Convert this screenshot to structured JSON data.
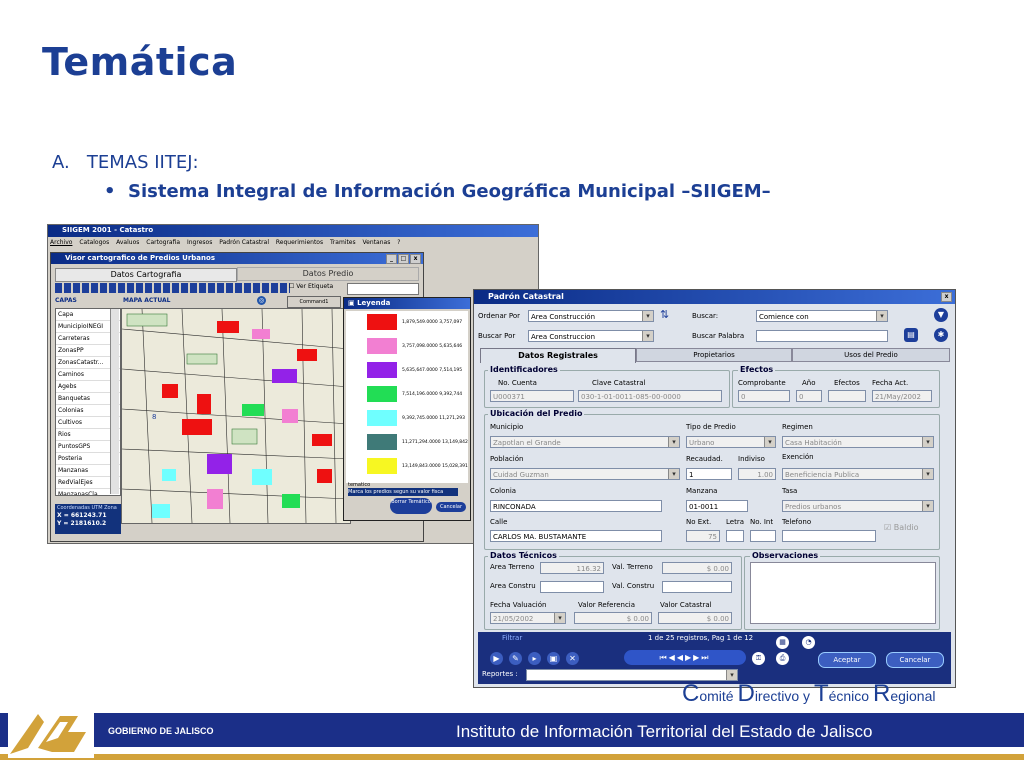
{
  "slide": {
    "title": "Temática",
    "list_marker": "A.",
    "list_item": "TEMAS IITEJ:",
    "bullet": "Sistema Integral de Información Geográfica Municipal –SIIGEM–"
  },
  "left_app": {
    "title": "SIIGEM 2001 - Catastro",
    "menu": [
      "Archivo",
      "Catalogos",
      "Avaluos",
      "Cartografia",
      "Ingresos",
      "Padrón Catastral",
      "Requerimientos",
      "Tramites",
      "Ventanas",
      "?"
    ],
    "viewer_title": "Visor cartografico de Predios Urbanos",
    "tab_active": "Datos Cartografia",
    "tab_other": "Datos Predio",
    "ver_etiqueta": "Ver Etiqueta",
    "capas_label": "CAPAS",
    "mapa_label": "MAPA ACTUAL",
    "command_label": "Command1",
    "layers": [
      "Capa",
      "MunicipioINEGI",
      "Carreteras",
      "ZonasPP",
      "ZonasCatastr...",
      "Caminos",
      "Agebs",
      "Banquetas",
      "Colonias",
      "Cultivos",
      "Rios",
      "PuntosGPS",
      "Posteria",
      "Manzanas",
      "RedVialEjes",
      "ManzanasCla"
    ],
    "coords_label": "Coordenadas UTM Zona",
    "coord_x": "X = 661243.71",
    "coord_y": "Y = 2181610.2",
    "legend_title": "Leyenda",
    "legend": [
      {
        "color": "#ee1111",
        "range": "1,879,549.0000  3,757,097"
      },
      {
        "color": "#f27fd2",
        "range": "3,757,098.0000  5,635,646"
      },
      {
        "color": "#9322e8",
        "range": "5,635,647.0000  7,514,195"
      },
      {
        "color": "#22dd55",
        "range": "7,514,196.0000  9,392,744"
      },
      {
        "color": "#6fffff",
        "range": "9,392,745.0000  11,271,293"
      },
      {
        "color": "#3f7a78",
        "range": "11,271,294.0000 13,149,842"
      },
      {
        "color": "#f7f722",
        "range": "13,149,843.0000 15,028,391"
      }
    ],
    "tematico_label": "tematico",
    "tematico_value": "Marca los predios segun su valor fisca",
    "borrar_label": "Borrar Temático",
    "cancel_label": "Cancelar"
  },
  "right_app": {
    "title": "Padrón Catastral",
    "ordenar_label": "Ordenar Por",
    "ordenar_value": "Area Construcción",
    "buscar_por_label": "Buscar Por",
    "buscar_por_value": "Area Construccion",
    "buscar_label": "Buscar:",
    "buscar_value": "Comience con",
    "buscar_palabra_label": "Buscar Palabra",
    "tabs": [
      "Datos Registrales",
      "Propietarios",
      "Usos del Predio"
    ],
    "identificadores": {
      "title": "Identificadores",
      "no_cuenta_label": "No. Cuenta",
      "no_cuenta": "U000371",
      "clave_label": "Clave Catastral",
      "clave": "030-1-01-0011-085-00-0000"
    },
    "efectos": {
      "title": "Efectos",
      "comprobante_label": "Comprobante",
      "comprobante": "0",
      "anio_label": "Año",
      "anio": "0",
      "efectos_label": "Efectos",
      "efectos": "",
      "fecha_label": "Fecha Act.",
      "fecha": "21/May/2002"
    },
    "ubicacion": {
      "title": "Ubicación del Predio",
      "municipio_label": "Municipio",
      "municipio": "Zapotlan el Grande",
      "tipo_label": "Tipo de Predio",
      "tipo": "Urbano",
      "regimen_label": "Regimen",
      "regimen": "Casa Habitación",
      "poblacion_label": "Población",
      "poblacion": "Cuidad Guzman",
      "recaudad_label": "Recaudad.",
      "recaudad": "1",
      "indiviso_label": "Indiviso",
      "indiviso": "1.00",
      "exencion_label": "Exención",
      "exencion": "Beneficiencia Publica",
      "colonia_label": "Colonia",
      "colonia": "RINCONADA",
      "manzana_label": "Manzana",
      "manzana": "01-0011",
      "tasa_label": "Tasa",
      "tasa": "Predios urbanos",
      "calle_label": "Calle",
      "calle": "CARLOS MA. BUSTAMANTE",
      "noext_label": "No Ext.",
      "noext": "75",
      "letra_label": "Letra",
      "noint_label": "No. Int",
      "telefono_label": "Telefono",
      "baldio_label": "Baldio"
    },
    "tecnicos": {
      "title": "Datos Técnicos",
      "area_terreno_label": "Area Terreno",
      "area_terreno": "116.32",
      "valor_terreno_label": "Val. Terreno",
      "valor_terreno": "$ 0.00",
      "area_constru_label": "Area Constru",
      "valor_constru_label": "Val. Constru",
      "fecha_val_label": "Fecha Valuación",
      "fecha_val": "21/05/2002",
      "valor_ref_label": "Valor Referencia",
      "valor_ref": "$ 0.00",
      "valor_cat_label": "Valor Catastral",
      "valor_cat": "$ 0.00"
    },
    "observaciones_title": "Observaciones",
    "filtrar_label": "Filtrar",
    "records": "1  de  25 registros, Pag 1 de 12",
    "reportes_label": "Reportes :",
    "aceptar_label": "Aceptar",
    "cancelar_label": "Cancelar"
  },
  "footer": {
    "comite": [
      "C",
      "omité ",
      "D",
      "irectivo  y  ",
      "T",
      "écnico ",
      "R",
      "egional"
    ],
    "gobierno": "GOBIERNO DE JALISCO",
    "instituto": "Instituto de Información Territorial del Estado de Jalisco"
  }
}
